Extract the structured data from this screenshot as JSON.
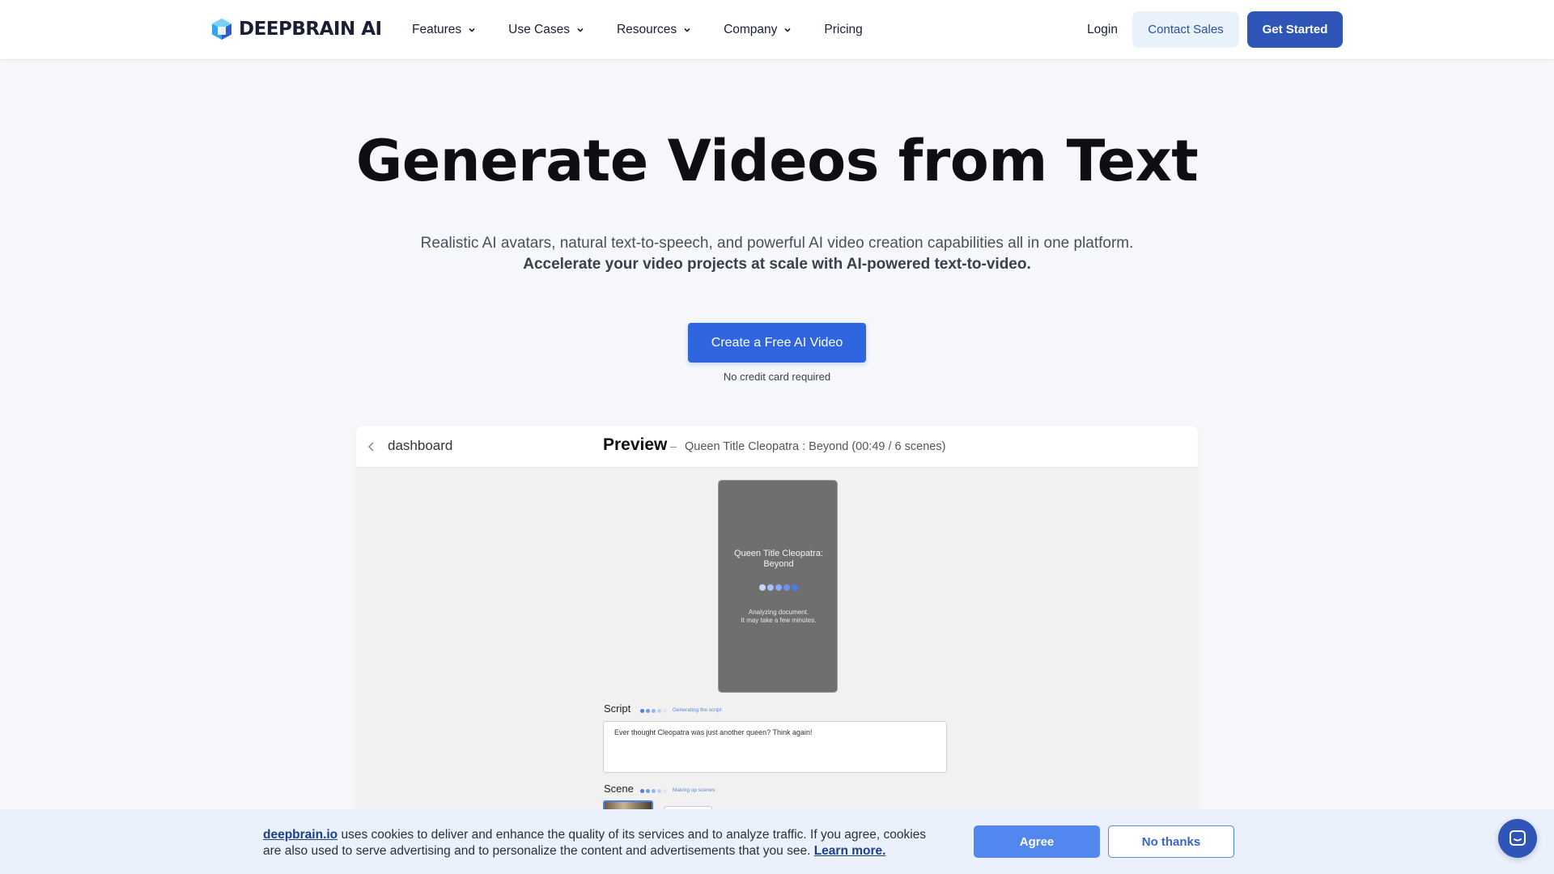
{
  "header": {
    "logo_text": "DEEPBRAIN AI",
    "nav": [
      {
        "label": "Features",
        "has_dropdown": true
      },
      {
        "label": "Use Cases",
        "has_dropdown": true
      },
      {
        "label": "Resources",
        "has_dropdown": true
      },
      {
        "label": "Company",
        "has_dropdown": true
      },
      {
        "label": "Pricing",
        "has_dropdown": false
      }
    ],
    "login_label": "Login",
    "contact_label": "Contact Sales",
    "get_started_label": "Get Started"
  },
  "hero": {
    "title": "Generate Videos from Text",
    "subtitle": "Realistic AI avatars, natural text-to-speech, and powerful AI video creation capabilities all in one platform.",
    "subtitle_bold": "Accelerate your video projects at scale with AI-powered text-to-video.",
    "cta_label": "Create a Free AI Video",
    "cta_note": "No credit card required"
  },
  "preview": {
    "back_label": "dashboard",
    "title": "Preview",
    "separator": "–",
    "meta": "Queen Title Cleopatra : Beyond (00:49 / 6 scenes)",
    "video_title": "Queen Title Cleopatra: Beyond",
    "video_note_line1": "Analyzing document.",
    "video_note_line2": "It may take a few minutes.",
    "script_label": "Script",
    "script_status": "Generating the script",
    "script_text": "Ever thought Cleopatra was just another queen? Think again!",
    "scene_label": "Scene",
    "scene_status": "Making up scenes"
  },
  "cookie": {
    "link_text": "deepbrain.io",
    "text": " uses cookies to deliver and enhance the quality of its services and to analyze traffic. If you agree, cookies are also used to serve advertising and to personalize the content and advertisements that you see. ",
    "learn_more": "Learn more.",
    "agree_label": "Agree",
    "no_thanks_label": "No thanks"
  },
  "colors": {
    "primary": "#2e55b7",
    "cta": "#2f66e0",
    "cookie_bg": "#eaf1fd"
  },
  "icons": [
    "deepbrain-logo-icon",
    "chevron-down-icon",
    "chevron-left-icon",
    "chat-icon"
  ]
}
